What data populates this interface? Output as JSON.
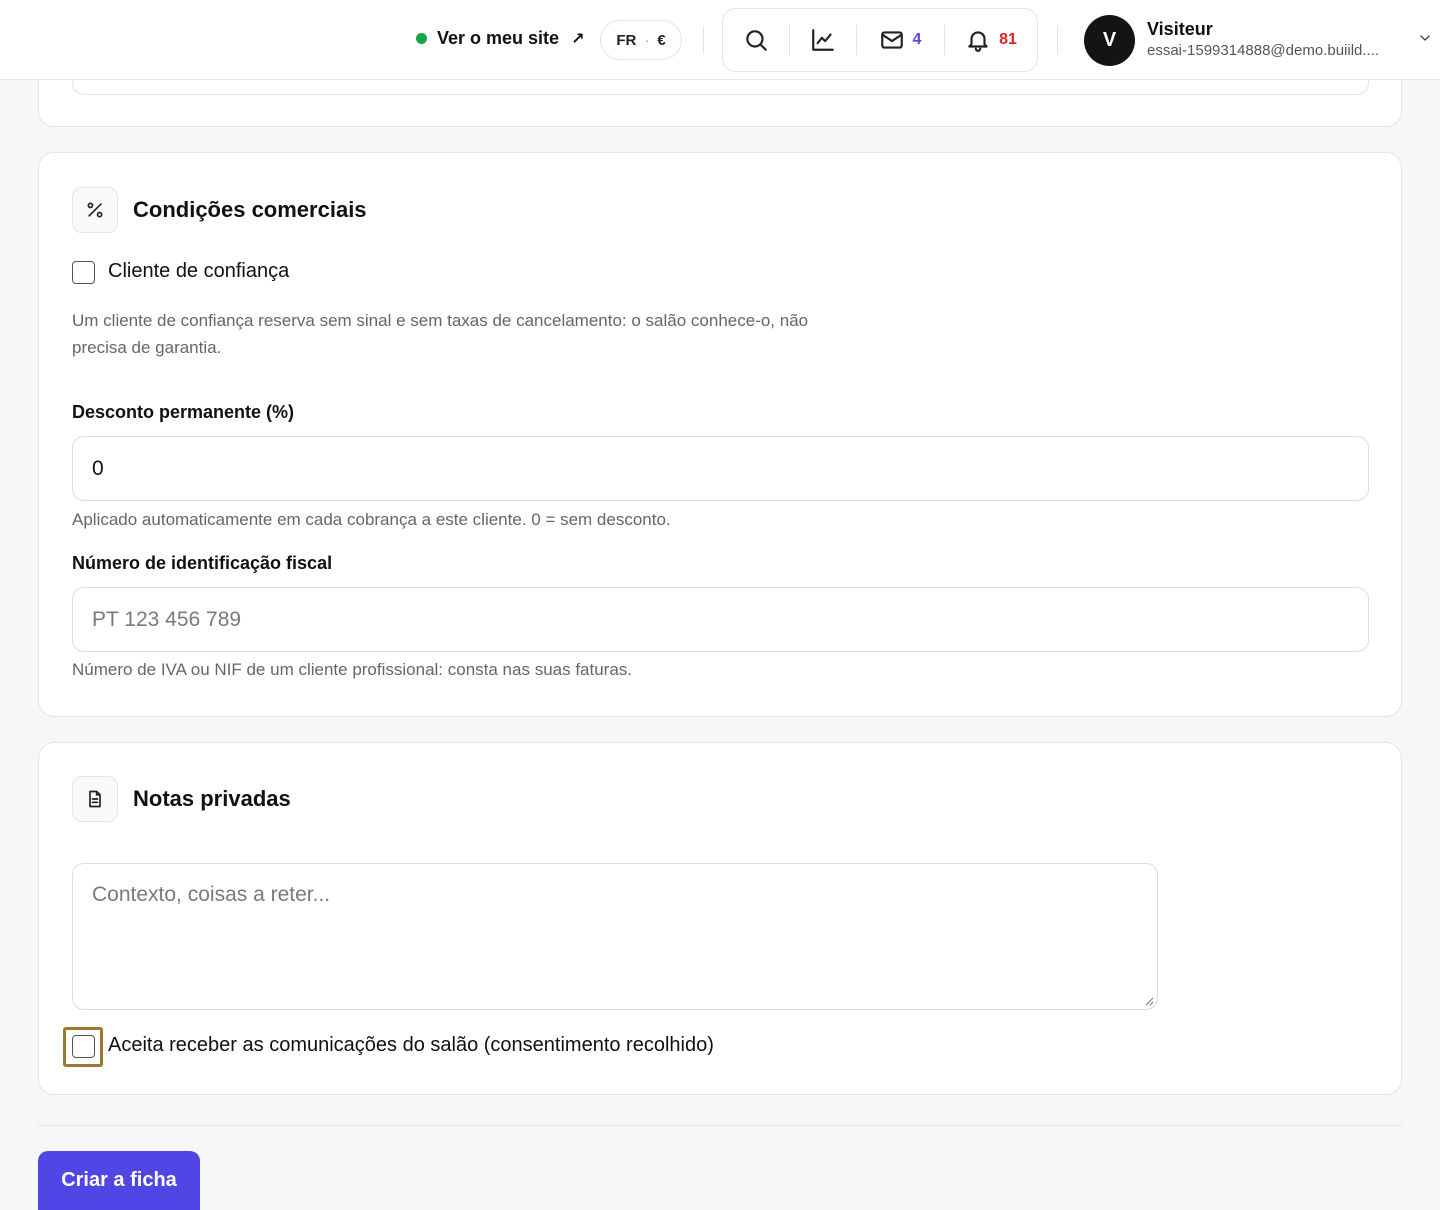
{
  "header": {
    "site_link": "Ver o meu site",
    "site_link_arrow": "↗",
    "locale": "FR",
    "locale_separator": "·",
    "currency": "€",
    "messages_count": "4",
    "notifications_count": "81",
    "user": {
      "initial": "V",
      "name": "Visiteur",
      "email": "essai-1599314888@demo.buiild...."
    },
    "icons": [
      "search-icon",
      "chart-icon",
      "mail-icon",
      "bell-icon",
      "chevron-down-icon"
    ],
    "status_color": "#16a34a"
  },
  "commercial": {
    "title": "Condições comerciais",
    "icon": "percent-icon",
    "trusted_client_label": "Cliente de confiança",
    "trusted_client_checked": false,
    "trusted_client_help_line1": "Um cliente de confiança reserva sem sinal e sem taxas de cancelamento: o salão conhece-o, não",
    "trusted_client_help_line2": "precisa de garantia.",
    "discount_label": "Desconto permanente (%)",
    "discount_value": "0",
    "discount_help": "Aplicado automaticamente em cada cobrança a este cliente. 0 = sem desconto.",
    "tax_id_label": "Número de identificação fiscal",
    "tax_id_placeholder": "PT 123 456 789",
    "tax_id_help": "Número de IVA ou NIF de um cliente profissional: consta nas suas faturas."
  },
  "notes": {
    "title": "Notas privadas",
    "icon": "document-icon",
    "placeholder": "Contexto, coisas a reter...",
    "consent_label": "Aceita receber as comunicações do salão (consentimento recolhido)",
    "consent_checked": false
  },
  "actions": {
    "submit_label": "Criar a ficha",
    "accent_color": "#4f46e5"
  }
}
